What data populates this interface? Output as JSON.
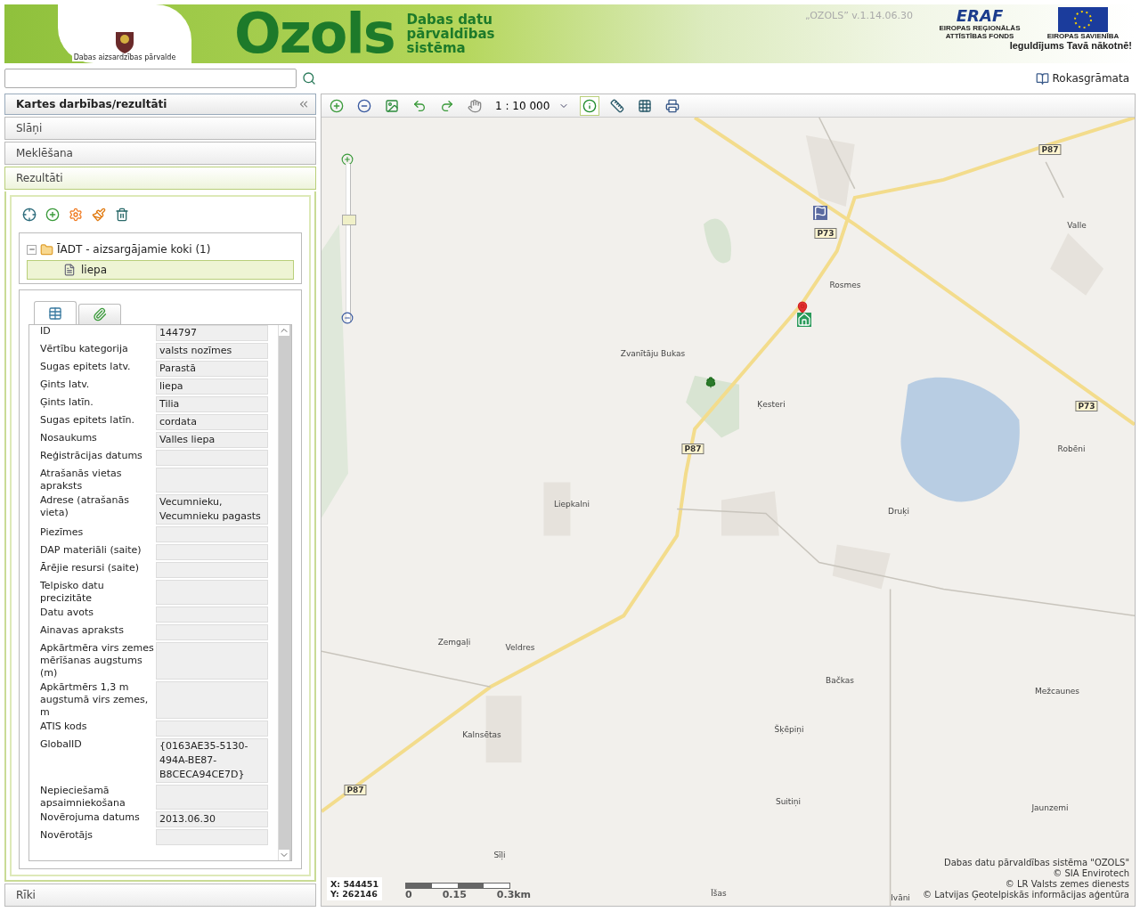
{
  "header": {
    "agency": "Dabas aizsardzības pārvalde",
    "logo_word": "Ozols",
    "subtitle_lines": [
      "Dabas datu",
      "pārvaldības",
      "sistēma"
    ],
    "version": "„OZOLS” v.1.14.06.30",
    "eraf_title": "ERAF",
    "eraf_caption": "EIROPAS REĢIONĀLĀS ATTĪSTĪBAS FONDS",
    "eu_caption": "EIROPAS SAVIENĪBA",
    "slogan": "Ieguldījums Tavā nākotnē!"
  },
  "search": {
    "kind": "text"
  },
  "manual_link": "Rokasgrāmata",
  "sidebar": {
    "title": "Kartes darbības/rezultāti",
    "sections": [
      {
        "label": "Slāņi",
        "expanded": false
      },
      {
        "label": "Meklēšana",
        "expanded": false
      },
      {
        "label": "Rezultāti",
        "expanded": true
      }
    ],
    "footer_section": {
      "label": "Rīki",
      "expanded": false
    }
  },
  "result_tools": [
    {
      "kind": "target"
    },
    {
      "kind": "add"
    },
    {
      "kind": "gear"
    },
    {
      "kind": "brush"
    },
    {
      "kind": "trash"
    }
  ],
  "result_tree": {
    "label": "ĪADT - aizsargājamie koki (1)",
    "expanded": true,
    "children": [
      {
        "label": "liepa",
        "selected": true
      }
    ]
  },
  "detail_tabs": [
    {
      "kind": "table",
      "selected": true
    },
    {
      "kind": "attachment",
      "selected": false
    }
  ],
  "attributes": [
    {
      "label": "ID",
      "value": "144797"
    },
    {
      "label": "Vērtību kategorija",
      "value": "valsts nozīmes"
    },
    {
      "label": "Sugas epitets latv.",
      "value": "Parastā"
    },
    {
      "label": "Ģints latv.",
      "value": "liepa"
    },
    {
      "label": "Ģints latīn.",
      "value": "Tilia"
    },
    {
      "label": "Sugas epitets latīn.",
      "value": "cordata"
    },
    {
      "label": "Nosaukums",
      "value": "Valles liepa"
    },
    {
      "label": "Reģistrācijas datums"
    },
    {
      "label": "Atrašanās vietas apraksts"
    },
    {
      "label": "Adrese (atrašanās vieta)",
      "value": "Vecumnieku, Vecumnieku pagasts"
    },
    {
      "label": "Piezīmes"
    },
    {
      "label": "DAP materiāli (saite)"
    },
    {
      "label": "Ārējie resursi (saite)"
    },
    {
      "label": "Telpisko datu precizitāte"
    },
    {
      "label": "Datu avots"
    },
    {
      "label": "Ainavas apraksts"
    },
    {
      "label": "Apkārtmēra virs zemes mērīšanas augstums (m)"
    },
    {
      "label": "Apkārtmērs 1,3 m augstumā virs zemes, m"
    },
    {
      "label": "ATIS kods"
    },
    {
      "label": "GlobalID",
      "value": "{0163AE35-5130-494A-BE87-B8CECA94CE7D}"
    },
    {
      "label": "Nepieciešamā apsaimniekošana"
    },
    {
      "label": "Novērojuma datums",
      "value": "2013.06.30"
    },
    {
      "label": "Novērotājs"
    }
  ],
  "map_toolbar": {
    "tools": [
      {
        "kind": "zoom-in",
        "selected": false
      },
      {
        "kind": "zoom-out",
        "selected": false
      },
      {
        "kind": "full-extent",
        "selected": false
      },
      {
        "kind": "back",
        "selected": false
      },
      {
        "kind": "forward",
        "selected": false
      },
      {
        "kind": "pan",
        "selected": false
      },
      {
        "kind": "scale",
        "selected": false
      },
      {
        "kind": "identify",
        "selected": true
      },
      {
        "kind": "measure",
        "selected": false
      },
      {
        "kind": "coordinates",
        "selected": false
      },
      {
        "kind": "print",
        "selected": false
      }
    ],
    "scale": "1 : 10 000"
  },
  "map": {
    "zoom": {
      "level": 0.68
    },
    "places": [
      "Valle",
      "Rosmes",
      "Zvanītāju Bukas",
      "Ķesteri",
      "Liepkalni",
      "Druķi",
      "Robēni",
      "Zemgaļi",
      "Veldres",
      "Bačkas",
      "Mežcaunes",
      "Kalnsētas",
      "Šķēpiņi",
      "Suitiņi",
      "Jaunzemi",
      "Sīļi",
      "Īšas",
      "Ivāni"
    ],
    "road_labels": [
      "P87",
      "P73",
      "P73",
      "P87",
      "P87"
    ],
    "coordinates": [
      "X: 544451",
      "Y: 262146"
    ],
    "scale_labels": [
      "0",
      "0.15",
      "0.3km"
    ],
    "attribution": [
      "Dabas datu pārvaldības sistēma \"OZOLS\"",
      "© SIA Envirotech",
      "© LR Valsts zemes dienests",
      "© Latvijas Ģeotelpiskās informācijas aģentūra"
    ]
  }
}
